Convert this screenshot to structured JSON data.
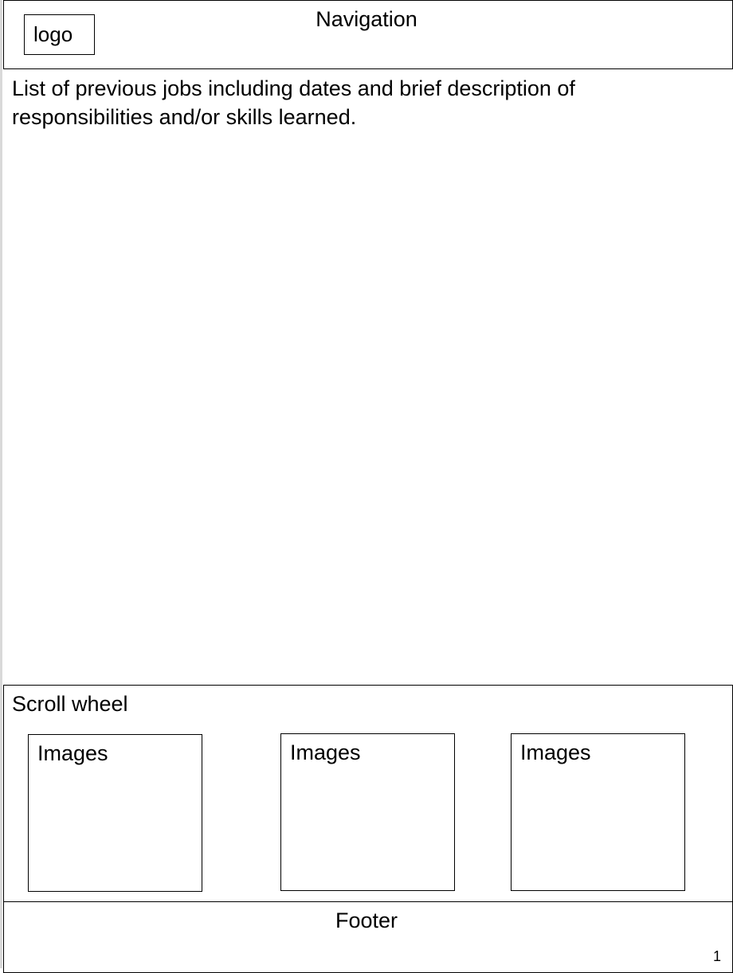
{
  "header": {
    "logo_label": "logo",
    "navigation_label": "Navigation"
  },
  "main": {
    "description": "List of previous jobs including dates and brief description of responsibilities and/or skills learned."
  },
  "gallery": {
    "label": "Scroll wheel",
    "images": [
      {
        "label": "Images"
      },
      {
        "label": "Images"
      },
      {
        "label": "Images"
      }
    ]
  },
  "footer": {
    "label": "Footer",
    "page_number": "1"
  }
}
